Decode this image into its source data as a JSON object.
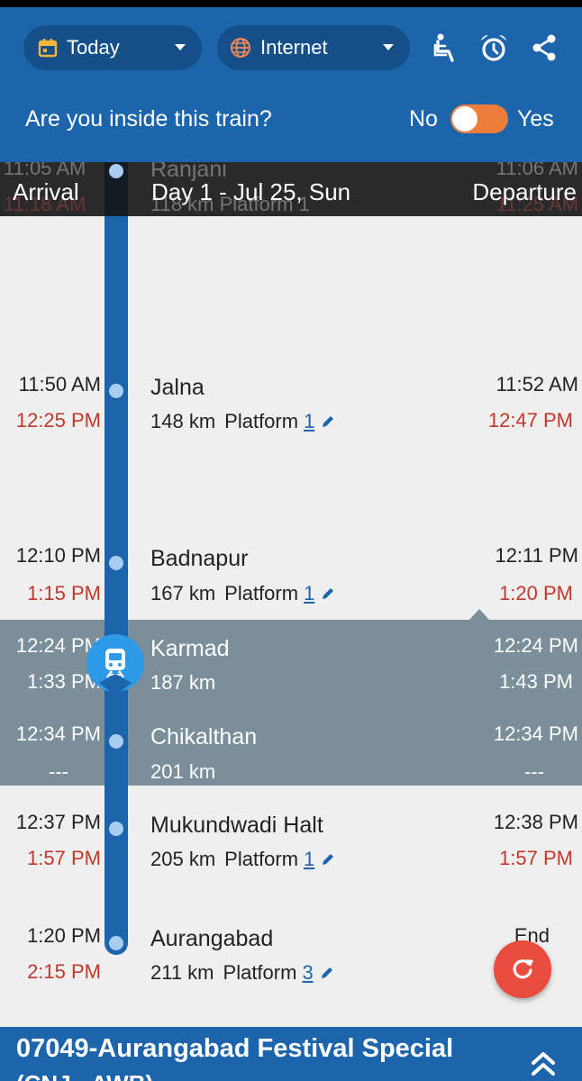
{
  "colors": {
    "primary": "#1c65ad",
    "pill": "#154f88",
    "delay_red": "#c0392b",
    "current_band": "#7a8f99",
    "toggle_orange": "#ef7d3a",
    "fab_red": "#e74c3c"
  },
  "toolbar": {
    "date_select": {
      "label": "Today",
      "icon": "calendar-icon"
    },
    "source_select": {
      "label": "Internet",
      "icon": "globe-icon"
    },
    "icons": [
      "seat-icon",
      "alarm-icon",
      "share-icon"
    ]
  },
  "inside_train": {
    "question": "Are you inside this train?",
    "no_label": "No",
    "yes_label": "Yes"
  },
  "day_header": {
    "arrival_label": "Arrival",
    "day_label": "Day 1 - Jul 25, Sun",
    "departure_label": "Departure",
    "partial_prev": {
      "arr_sched": "11:05 AM",
      "arr_actual": "11:18 AM",
      "name": "Ranjani",
      "info": "118 km Platform 1",
      "dep_sched": "11:06 AM",
      "dep_actual": "11:25 AM"
    }
  },
  "stations": [
    {
      "name": "Jalna",
      "distance": "148 km",
      "platform_label": "Platform",
      "platform": "1",
      "arr_sched": "11:50 AM",
      "arr_actual": "12:25 PM",
      "dep_sched": "11:52 AM",
      "dep_actual": "12:47 PM"
    },
    {
      "name": "Badnapur",
      "distance": "167 km",
      "platform_label": "Platform",
      "platform": "1",
      "arr_sched": "12:10 PM",
      "arr_actual": "1:15 PM",
      "dep_sched": "12:11 PM",
      "dep_actual": "1:20 PM"
    },
    {
      "name": "Karmad",
      "distance": "187 km",
      "arr_sched": "12:24 PM",
      "arr_actual": "1:33 PM",
      "dep_sched": "12:24 PM",
      "dep_actual": "1:43 PM"
    },
    {
      "name": "Chikalthan",
      "distance": "201 km",
      "arr_sched": "12:34 PM",
      "arr_actual": "---",
      "dep_sched": "12:34 PM",
      "dep_actual": "---"
    },
    {
      "name": "Mukundwadi Halt",
      "distance": "205 km",
      "platform_label": "Platform",
      "platform": "1",
      "arr_sched": "12:37 PM",
      "arr_actual": "1:57 PM",
      "dep_sched": "12:38 PM",
      "dep_actual": "1:57 PM"
    },
    {
      "name": "Aurangabad",
      "distance": "211 km",
      "platform_label": "Platform",
      "platform": "3",
      "arr_sched": "1:20 PM",
      "arr_actual": "2:15 PM",
      "dep_sched": "End",
      "dep_actual": ""
    }
  ],
  "bottom": {
    "train_title": "07049-Aurangabad Festival Special",
    "train_sub": "(CNJ - AWB)"
  }
}
